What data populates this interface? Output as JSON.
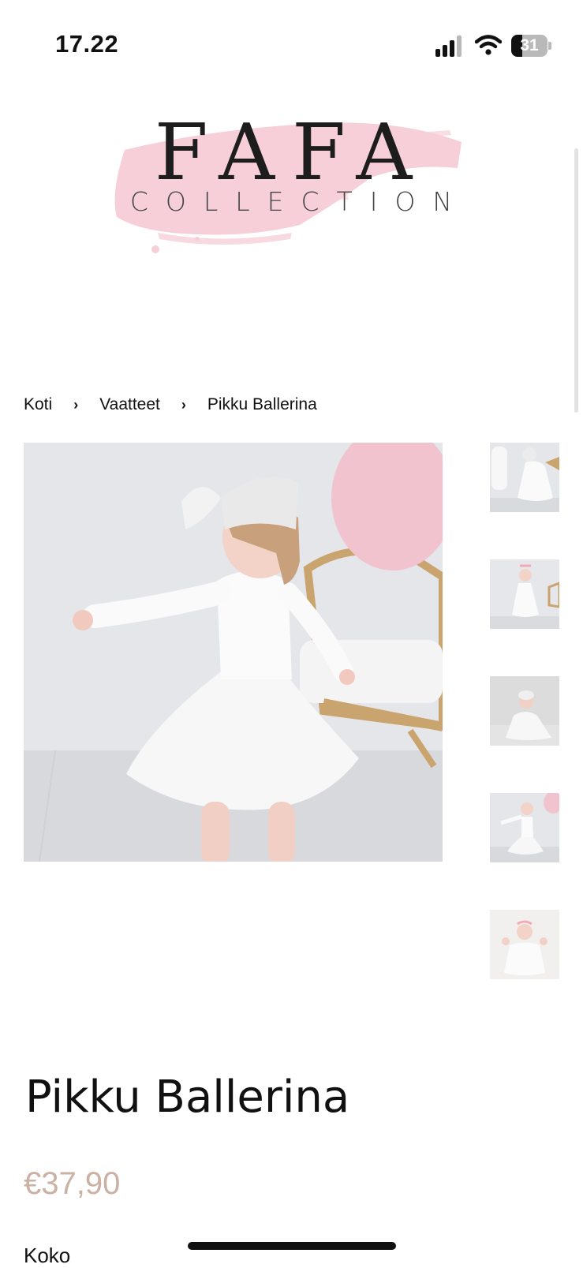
{
  "status_bar": {
    "time": "17.22",
    "battery_level": "31",
    "battery_fraction": 0.31,
    "signal_bars": 3,
    "icons": [
      "cellular-signal-icon",
      "wifi-icon",
      "battery-icon"
    ]
  },
  "logo": {
    "title": "FAFA",
    "subtitle": "COLLECTION",
    "brush_color": "#f6cfd8"
  },
  "breadcrumb": {
    "items": [
      "Koti",
      "Vaatteet",
      "Pikku Ballerina"
    ],
    "separator": "›"
  },
  "gallery": {
    "main_image": "girl-in-white-tutu-dress",
    "thumbnails": [
      "thumbnail-1",
      "thumbnail-2",
      "thumbnail-3",
      "thumbnail-4",
      "thumbnail-5"
    ]
  },
  "product": {
    "title": "Pikku Ballerina",
    "price": "€37,90",
    "size_label": "Koko",
    "price_color": "#cbb0a4"
  }
}
